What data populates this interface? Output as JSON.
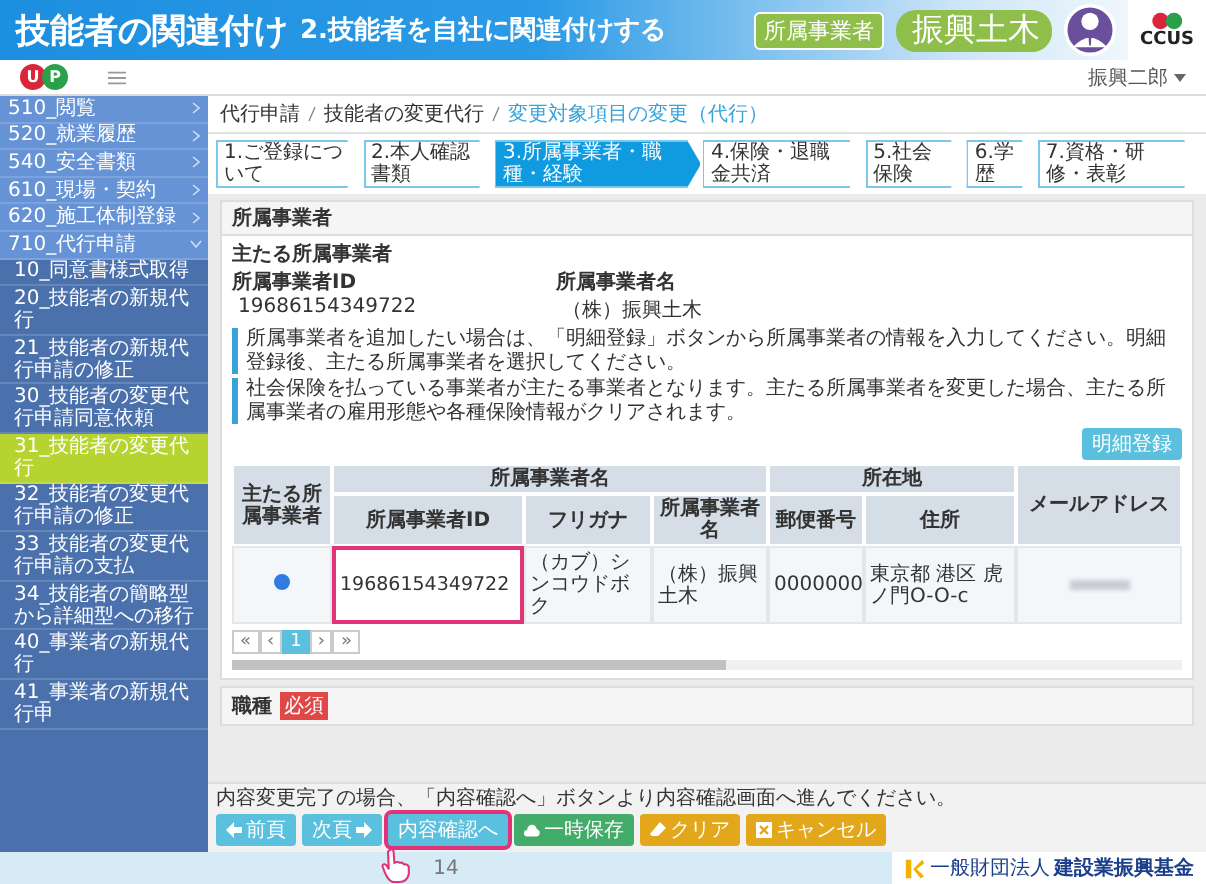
{
  "slide": {
    "title": "技能者の関連付け",
    "subtitle": "2.技能者を自社に関連付けする",
    "role_badge": "所属事業者",
    "company": "振興土木",
    "logo_text": "CCUS",
    "page_number": "14",
    "footer_logo_small": "一般財団法人",
    "footer_logo": "建設業振興基金"
  },
  "app": {
    "logo_letters": [
      "U",
      "P"
    ],
    "user": "振興二郎",
    "sidebar": [
      {
        "label": "510_閲覧",
        "expanded": false,
        "selected": false
      },
      {
        "label": "520_就業履歴",
        "expanded": false,
        "selected": false
      },
      {
        "label": "540_安全書類",
        "expanded": false,
        "selected": false
      },
      {
        "label": "610_現場・契約",
        "expanded": false,
        "selected": false
      },
      {
        "label": "620_施工体制登録",
        "expanded": false,
        "selected": false
      },
      {
        "label": "710_代行申請",
        "expanded": true,
        "selected": false,
        "children": [
          {
            "label": "10_同意書様式取得",
            "selected": false
          },
          {
            "label": "20_技能者の新規代行",
            "selected": false
          },
          {
            "label": "21_技能者の新規代行申請の修正",
            "selected": false
          },
          {
            "label": "30_技能者の変更代行申請同意依頼",
            "selected": false
          },
          {
            "label": "31_技能者の変更代行",
            "selected": true
          },
          {
            "label": "32_技能者の変更代行申請の修正",
            "selected": false
          },
          {
            "label": "33_技能者の変更代行申請の支払",
            "selected": false
          },
          {
            "label": "34_技能者の簡略型から詳細型への移行",
            "selected": false
          },
          {
            "label": "40_事業者の新規代行",
            "selected": false
          },
          {
            "label": "41_事業者の新規代行申",
            "selected": false
          }
        ]
      }
    ],
    "breadcrumb": [
      "代行申請",
      "技能者の変更代行",
      "変更対象項目の変更（代行）"
    ],
    "steps": [
      {
        "label": "1.ご登録について",
        "selected": false
      },
      {
        "label": "2.本人確認書類",
        "selected": false
      },
      {
        "label": "3.所属事業者・職種・経験",
        "selected": true
      },
      {
        "label": "4.保険・退職金共済",
        "selected": false
      },
      {
        "label": "5.社会保険",
        "selected": false
      },
      {
        "label": "6.学歴",
        "selected": false
      },
      {
        "label": "7.資格・研修・表彰",
        "selected": false
      }
    ],
    "card": {
      "title": "所属事業者",
      "heading": "主たる所属事業者",
      "fields": [
        {
          "label": "所属事業者ID",
          "value": "19686154349722"
        },
        {
          "label": "所属事業者名",
          "value": "（株）振興土木"
        }
      ],
      "notes": [
        "所属事業者を追加したい場合は、「明細登録」ボタンから所属事業者の情報を入力してください。明細登録後、主たる所属事業者を選択してください。",
        "社会保険を払っている事業者が主たる事業者となります。主たる所属事業者を変更した場合、主たる所属事業者の雇用形態や各種保険情報がクリアされます。"
      ],
      "add_button": "明細登録",
      "table": {
        "group_headers": {
          "main": "主たる所属事業者",
          "company": "所属事業者名",
          "location": "所在地",
          "email": "メールアドレス"
        },
        "columns": [
          "所属事業者ID",
          "フリガナ",
          "所属事業者名",
          "郵便番号",
          "住所"
        ],
        "rows": [
          {
            "selected": true,
            "cells": [
              {
                "text": "19686154349722",
                "highlighted": true
              },
              {
                "text": "（カブ）シンコウドボク",
                "highlighted": false
              },
              {
                "text": "（株）振興土木",
                "highlighted": false
              },
              {
                "text": "0000000",
                "highlighted": false
              },
              {
                "text": "東京都 港区 虎ノ門O-O-c",
                "highlighted": false
              }
            ]
          }
        ]
      },
      "pagination": [
        {
          "label": "«",
          "selected": false
        },
        {
          "label": "‹",
          "selected": false
        },
        {
          "label": "1",
          "selected": true
        },
        {
          "label": "›",
          "selected": false
        },
        {
          "label": "»",
          "selected": false
        }
      ]
    },
    "section2": {
      "title": "職種",
      "badge": "必須"
    },
    "bottom": {
      "note": "内容変更完了の場合、「内容確認へ」ボタンより内容確認画面へ進んでください。",
      "buttons": [
        {
          "label": "前頁",
          "kind": "prev",
          "highlighted": false
        },
        {
          "label": "次頁",
          "kind": "next",
          "highlighted": false
        },
        {
          "label": "内容確認へ",
          "kind": "confirm",
          "highlighted": true
        },
        {
          "label": "一時保存",
          "kind": "save",
          "highlighted": false
        },
        {
          "label": "クリア",
          "kind": "clear",
          "highlighted": false
        },
        {
          "label": "キャンセル",
          "kind": "cancel",
          "highlighted": false
        }
      ]
    }
  }
}
